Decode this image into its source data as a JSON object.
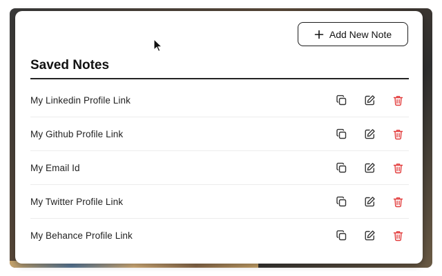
{
  "header": {
    "add_button_label": "Add New Note",
    "title": "Saved Notes"
  },
  "notes": [
    {
      "label": "My Linkedin Profile Link"
    },
    {
      "label": "My Github Profile Link"
    },
    {
      "label": "My Email Id"
    },
    {
      "label": "My Twitter Profile Link"
    },
    {
      "label": "My Behance Profile Link"
    }
  ],
  "icons": {
    "add": "plus-icon",
    "copy": "copy-icon",
    "edit": "edit-icon",
    "delete": "trash-icon",
    "cursor": "mouse-pointer-icon"
  },
  "colors": {
    "delete": "#e23a3a",
    "icon": "#333333",
    "text": "#1f1f1f"
  }
}
